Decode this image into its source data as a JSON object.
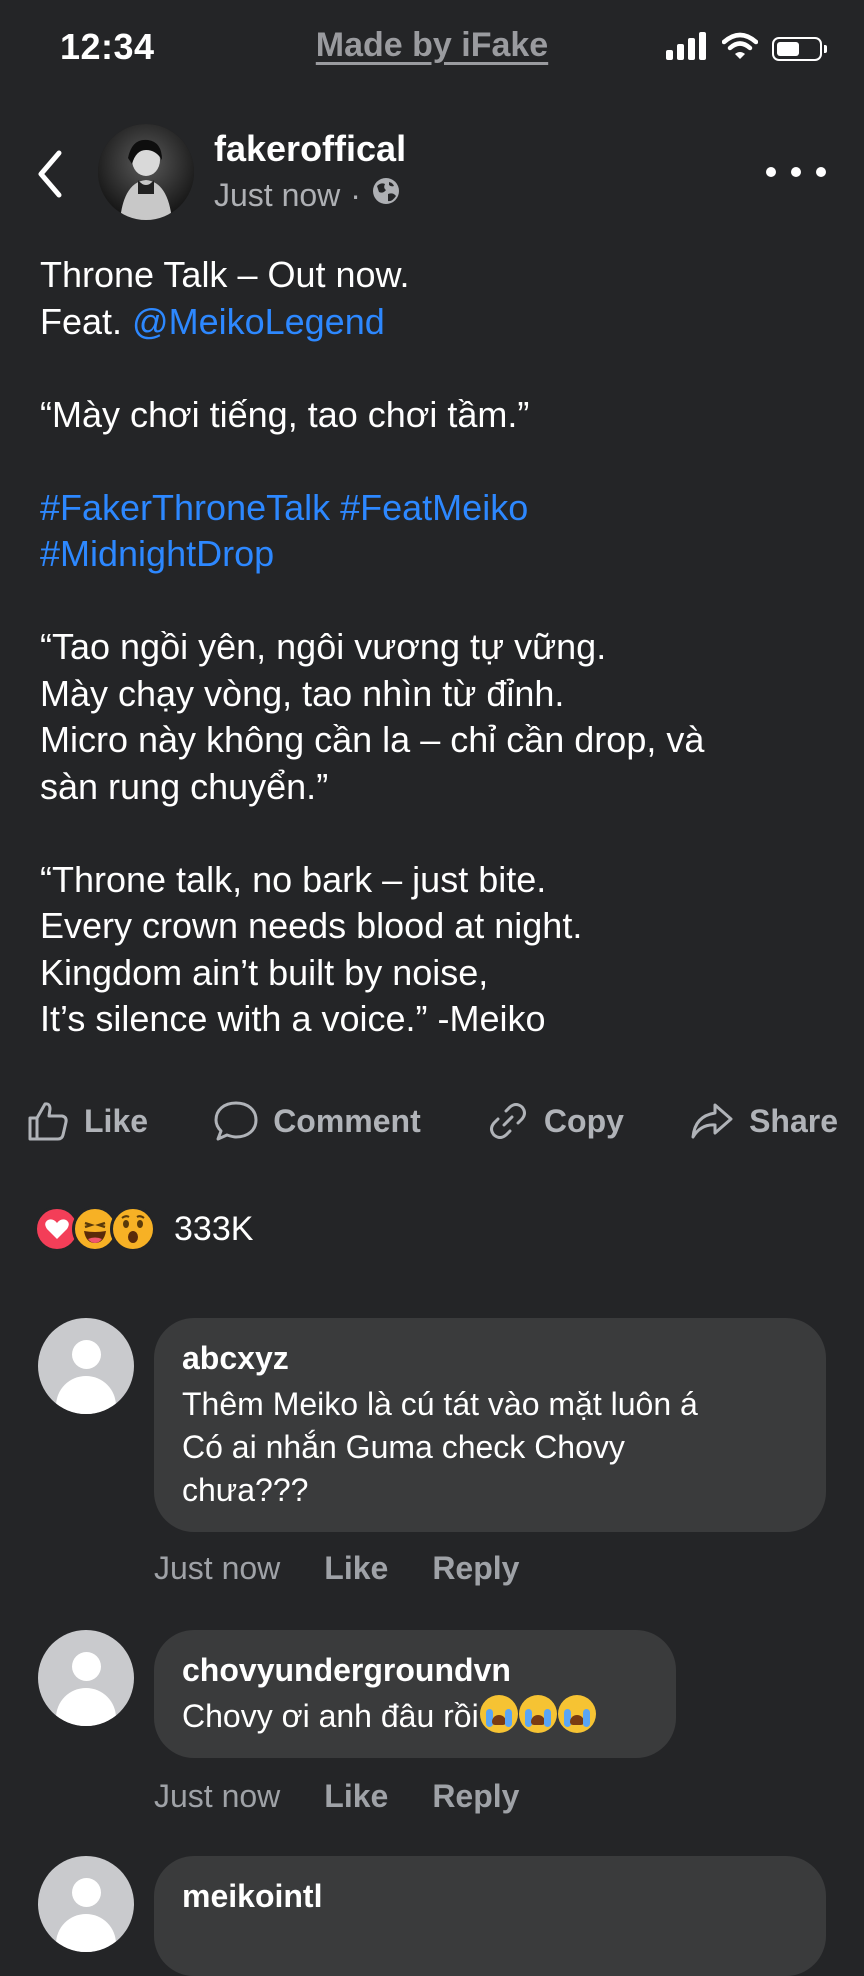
{
  "status_bar": {
    "time": "12:34",
    "watermark": "Made by iFake",
    "battery_level": 0.55
  },
  "post": {
    "author": "fakeroffical",
    "timestamp": "Just now",
    "separator": "·",
    "body": {
      "line1": "Throne Talk – Out now.",
      "line2_prefix": "Feat. ",
      "mention": "@MeikoLegend",
      "quote1": "“Mày chơi tiếng, tao chơi tầm.”",
      "hashtags_line1": "#FakerThroneTalk #FeatMeiko",
      "hashtags_line2": "#MidnightDrop",
      "verse1": [
        "“Tao ngồi yên, ngôi vương tự vững.",
        "Mày chạy vòng, tao nhìn từ đỉnh.",
        "Micro này không cần la – chỉ cần drop, và",
        "sàn rung chuyển.”"
      ],
      "verse2": [
        "“Throne talk, no bark – just bite.",
        "Every crown needs blood at night.",
        "Kingdom ain’t built by noise,",
        "It’s silence with a voice.” -Meiko"
      ]
    },
    "actions": {
      "like": "Like",
      "comment": "Comment",
      "copy": "Copy",
      "share": "Share"
    },
    "reactions": {
      "icons": [
        "love-reaction",
        "haha-reaction",
        "wow-reaction"
      ],
      "count": "333K"
    }
  },
  "comments": [
    {
      "username": "abcxyz",
      "lines": [
        "Thêm Meiko là cú tát vào mặt luôn á",
        "Có ai nhắn Guma check Chovy",
        "chưa???"
      ],
      "time": "Just now",
      "like": "Like",
      "reply": "Reply"
    },
    {
      "username": "chovyundergroundvn",
      "text": "Chovy ơi anh đâu rồi",
      "emoji": "loudly-crying-face",
      "time": "Just now",
      "like": "Like",
      "reply": "Reply"
    },
    {
      "username": "meikointl"
    }
  ],
  "colors": {
    "background": "#242527",
    "link": "#2d88ff",
    "bubble": "#3a3b3c",
    "muted_text": "#b0b3b8"
  }
}
